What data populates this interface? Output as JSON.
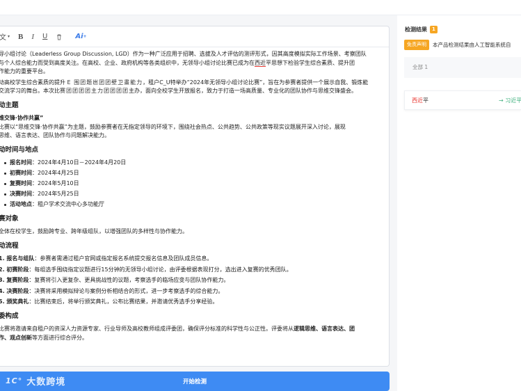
{
  "toolbar": {
    "font_label": "文",
    "bold_label": "B",
    "italic_label": "I",
    "underline_label": "U",
    "ai_label": "Ai",
    "ai_sup": "+"
  },
  "doc": {
    "intro1_a": "导小组讨论（Leaderless Group Discussion, LGD）作为一种广泛应用于招聘、选拔及人才评估的测评形式，因其高度模拟实际工作场景、考察团队",
    "intro1_b": "与个人综合能力而受到高度关注。在高校、企业、政府机构等各类组织中，无领导小组讨论比赛已成为在",
    "intro1_mark": "西近",
    "intro1_c": "平思想下检验学生综合素质、提升团",
    "intro1_d": "作能力的重要平台。",
    "intro2_a": "动高校学生综合素质的提升",
    "intro2_garble": "E 围团题岜团团壁卫畫能力",
    "intro2_b": "，租户C_U特举办“2024年无领导小组讨论比赛”，旨在为参赛者提供一个展示自我、锻炼能",
    "intro2_c": "交流学习的舞台。本次比",
    "intro2_garble2": "赛团团团团主力团团团团",
    "intro2_d": "主办，面向全校学生开放报名，致力于打造一场高质量、专业化的团队协作与思维交锋盛会。",
    "sec1_title": "动主题",
    "theme_title": "维交锋·协作共赢”",
    "theme_a": "比赛以“思维交锋·协作共赢”为主题，鼓励参赛者在无指定领导的环境下，围绕社会热点、公共趋势、公共政策等现实议题展开深入讨论，展现",
    "theme_b": "思维、语言表达、团队协作与问题解决能力。",
    "sec2_title": "动时间与地点",
    "schedule": [
      {
        "label": "报名时间",
        "value": "：2024年4月10日－2024年4月20日"
      },
      {
        "label": "初赛时间",
        "value": "：2024年4月25日"
      },
      {
        "label": "复赛时间",
        "value": "：2024年5月10日"
      },
      {
        "label": "决赛时间",
        "value": "：2024年5月25日"
      },
      {
        "label": "活动地点",
        "value": "：租户学术交流中心多功能厅"
      }
    ],
    "sec3_title": "赛对象",
    "audience": "全体在校学生，鼓励跨专业、跨年级组队，以增强团队的多样性与协作能力。",
    "sec4_title": "动流程",
    "steps": [
      {
        "label": "1. 报名与组队",
        "value": "：参赛者需通过租户官网或指定报名系统提交报名信息及团队成员信息。"
      },
      {
        "label": "2. 初赛阶段",
        "value": "：每组选手围绕指定议题进行15分钟的无领导小组讨论，由评委根据表现打分，选出进入复赛的优秀团队。"
      },
      {
        "label": "3. 复赛阶段",
        "value": "：复赛将引入更复杂、更具挑战性的议题，考察选手的临场应变与团队协作能力。"
      },
      {
        "label": "4. 决赛阶段",
        "value": "：决赛将采用模拟辩论与案例分析相结合的形式，进一步考察选手的综合能力。"
      },
      {
        "label": "5. 颁奖典礼",
        "value": "：比赛结束后，将举行颁奖典礼，公布比赛结果，并邀请优秀选手分享经验。"
      }
    ],
    "sec5_title": "委构成",
    "judges_a": "比赛将邀请来自租户的资深人力资源专家、行业导师及高校教师组成评委团，确保评分标准的科学性与公正性。评委将从",
    "judges_bold1": "逻辑思维、语言表达、团",
    "judges_bold2": "作、观点创新",
    "judges_b": "等方面进行综合评分。"
  },
  "start_button": "开始检测",
  "logo": {
    "mark": "1C°",
    "text": "大数跨境"
  },
  "right": {
    "title": "检测结果",
    "count": "1",
    "notice_tag": "免责声明",
    "notice_text": "本产品检测结果由人工智能系统自",
    "filter_all": "全部 1",
    "result_wrong": "西近",
    "result_rest": "平",
    "result_arrow": "→",
    "result_fix": "习近平"
  }
}
